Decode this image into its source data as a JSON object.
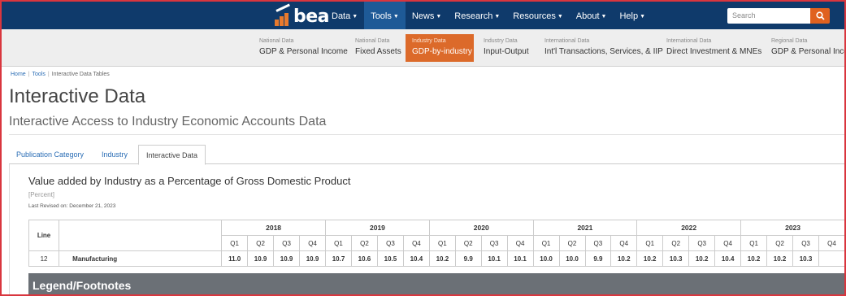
{
  "brand": {
    "logo_text": "bea"
  },
  "topnav": {
    "items": [
      {
        "label": "Data"
      },
      {
        "label": "Tools"
      },
      {
        "label": "News"
      },
      {
        "label": "Research"
      },
      {
        "label": "Resources"
      },
      {
        "label": "About"
      },
      {
        "label": "Help"
      }
    ],
    "active": "Tools",
    "search_placeholder": "Search",
    "colors": {
      "bar": "#0f3a6b",
      "active": "#1e5a97",
      "search_button": "#e0611f"
    }
  },
  "subnav": {
    "items": [
      {
        "small": "National Data",
        "label": "GDP & Personal Income"
      },
      {
        "small": "National Data",
        "label": "Fixed Assets"
      },
      {
        "small": "Industry Data",
        "label": "GDP-by-industry"
      },
      {
        "small": "Industry Data",
        "label": "Input-Output"
      },
      {
        "small": "International Data",
        "label": "Int'l Transactions, Services, & IIP"
      },
      {
        "small": "International Data",
        "label": "Direct Investment & MNEs"
      },
      {
        "small": "Regional Data",
        "label": "GDP & Personal Income"
      }
    ],
    "active": "GDP-by-industry",
    "active_color": "#dc6a2a"
  },
  "breadcrumb": {
    "home": "Home",
    "tools": "Tools",
    "current": "Interactive Data Tables"
  },
  "page": {
    "title": "Interactive Data",
    "subtitle": "Interactive Access to Industry Economic Accounts Data"
  },
  "tabs": [
    {
      "label": "Publication Category"
    },
    {
      "label": "Industry"
    },
    {
      "label": "Interactive Data"
    }
  ],
  "table": {
    "title": "Value added by Industry as a Percentage of Gross Domestic Product",
    "unit": "[Percent]",
    "revised": "Last Revised on: December 21, 2023",
    "line_header": "Line",
    "years": [
      "2018",
      "2019",
      "2020",
      "2021",
      "2022",
      "2023"
    ],
    "quarters": [
      "Q1",
      "Q2",
      "Q3",
      "Q4"
    ],
    "rows": [
      {
        "line": "12",
        "name": "Manufacturing",
        "values": [
          "11.0",
          "10.9",
          "10.9",
          "10.9",
          "10.7",
          "10.6",
          "10.5",
          "10.4",
          "10.2",
          "9.9",
          "10.1",
          "10.1",
          "10.0",
          "10.0",
          "9.9",
          "10.2",
          "10.2",
          "10.3",
          "10.2",
          "10.4",
          "10.2",
          "10.2",
          "10.3"
        ]
      }
    ]
  },
  "legend": {
    "label": "Legend/Footnotes"
  }
}
